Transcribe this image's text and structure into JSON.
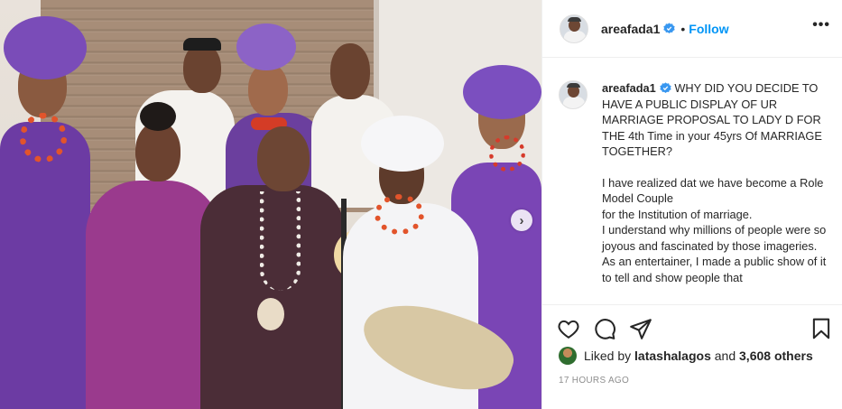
{
  "post": {
    "username": "areafada1",
    "follow_label": "Follow",
    "separator": "•",
    "more_label": "•••",
    "caption_username": "areafada1",
    "caption_paragraphs": [
      "WHY DID YOU DECIDE TO HAVE A PUBLIC DISPLAY OF UR MARRIAGE PROPOSAL TO LADY D FOR THE 4th Time in your 45yrs Of MARRIAGE TOGETHER?",
      "I have realized dat we have become a Role Model Couple\nfor the Institution of marriage.\nI understand why millions of people were so joyous and fascinated by those imageries.\nAs an entertainer, I made a public show of it to tell and show people that"
    ],
    "liked_by_prefix": "Liked by",
    "liked_by_user": "latashalagos",
    "liked_by_and": "and",
    "liked_by_count": "3,608 others",
    "timestamp": "17 HOURS AGO"
  },
  "icons": {
    "verified": "verified-badge-icon",
    "heart": "heart-icon",
    "comment": "comment-icon",
    "share": "share-icon",
    "save": "bookmark-icon",
    "next": "chevron-right-icon",
    "more": "more-options-icon"
  },
  "colors": {
    "link_blue": "#0095f6",
    "verified_blue": "#3897f0",
    "muted": "#8e8e8e",
    "text": "#262626"
  }
}
